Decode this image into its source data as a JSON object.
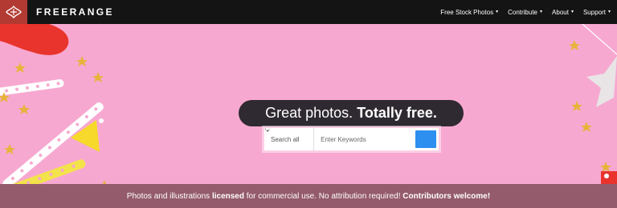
{
  "brand": {
    "name": "FREERANGE",
    "logo_icon": "freerange-logo-icon",
    "logo_color": "#b23a32"
  },
  "nav": {
    "items": [
      {
        "label": "Free Stock Photos",
        "icon": "chevron-down-icon"
      },
      {
        "label": "Contribute",
        "icon": "chevron-down-icon"
      },
      {
        "label": "About",
        "icon": "chevron-down-icon"
      },
      {
        "label": "Support",
        "icon": "chevron-down-icon"
      }
    ]
  },
  "hero": {
    "headline_regular": "Great photos.",
    "headline_bold": "Totally free.",
    "background_color": "#f7a8d0"
  },
  "search": {
    "scope_label": "Search all",
    "placeholder": "Enter Keywords",
    "button_icon": "search-icon",
    "button_color": "#2d8ff0"
  },
  "banner": {
    "part1": "Photos and illustrations ",
    "part1_bold": "licensed",
    "part2": " for commercial use. No attribution required! ",
    "part2_bold": "Contributors welcome!"
  }
}
